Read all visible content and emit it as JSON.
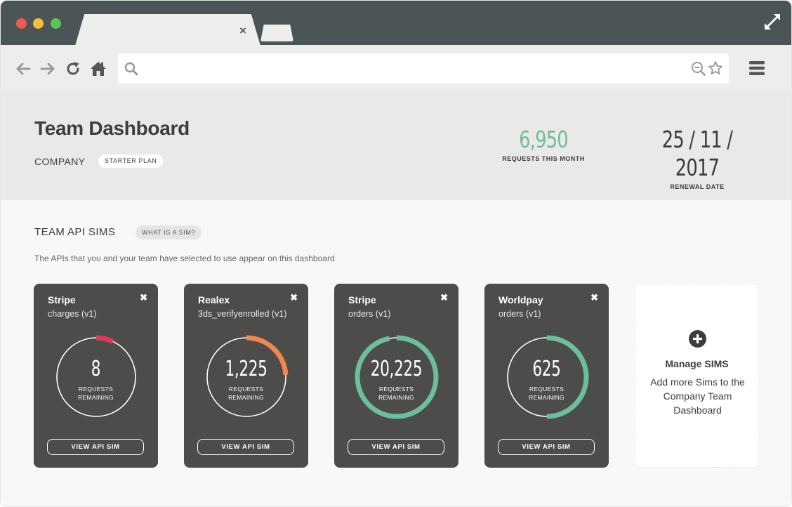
{
  "browser": {
    "tab_close": "×"
  },
  "header": {
    "title": "Team Dashboard",
    "company": "COMPANY",
    "plan": "STARTER PLAN",
    "requests_value": "6,950",
    "requests_label": "REQUESTS THIS MONTH",
    "renewal_value": "25 / 11 / 2017",
    "renewal_label": "RENEWAL DATE"
  },
  "section": {
    "title": "TEAM API SIMS",
    "badge": "WHAT IS A SIM?",
    "description": "The APIs that you and your team have selected to use appear on this dashboard"
  },
  "cards": [
    {
      "name": "Stripe",
      "endpoint": "charges  (v1)",
      "close": "✖",
      "value": "8",
      "label": "REQUESTS\nREMAINING",
      "fraction": 0.07,
      "color": "#e5375a",
      "button": "VIEW API SIM"
    },
    {
      "name": "Realex",
      "endpoint": "3ds_verifyenrolled  (v1)",
      "close": "✖",
      "value": "1,225",
      "label": "REQUESTS\nREMAINING",
      "fraction": 0.24,
      "color": "#f0874e",
      "button": "VIEW API SIM"
    },
    {
      "name": "Stripe",
      "endpoint": "orders  (v1)",
      "close": "✖",
      "value": "20,225",
      "label": "REQUESTS\nREMAINING",
      "fraction": 0.97,
      "color": "#6bbf9c",
      "button": "VIEW API SIM"
    },
    {
      "name": "Worldpay",
      "endpoint": "orders  (v1)",
      "close": "✖",
      "value": "625",
      "label": "REQUESTS\nREMAINING",
      "fraction": 0.5,
      "color": "#6bbf9c",
      "button": "VIEW API SIM"
    }
  ],
  "manage": {
    "title": "Manage SIMS",
    "description": "Add more Sims to the Company Team Dashboard"
  },
  "colors": {
    "accent_green": "#6bbf9c",
    "card_bg": "#4c4c4b",
    "titlebar": "#4b5557"
  }
}
